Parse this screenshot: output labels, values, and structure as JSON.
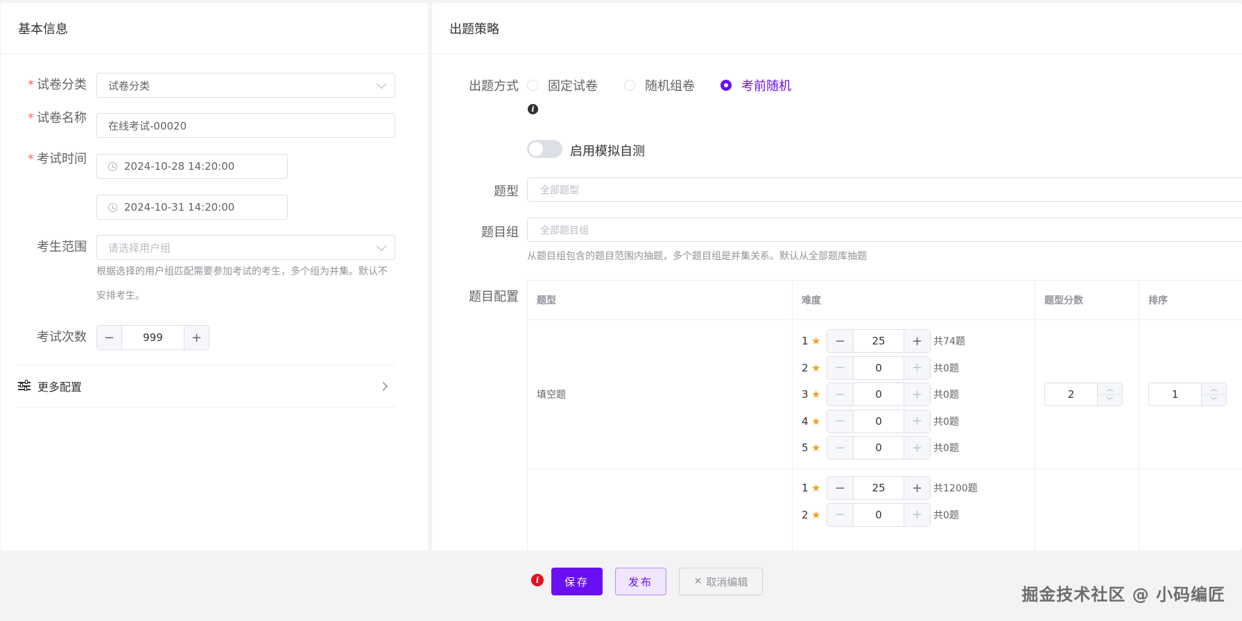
{
  "basic": {
    "title": "基本信息",
    "category": {
      "label": "试卷分类",
      "value": "试卷分类"
    },
    "name": {
      "label": "试卷名称",
      "value": "在线考试-00020"
    },
    "exam_time": {
      "label": "考试时间",
      "start": "2024-10-28 14:20:00",
      "end": "2024-10-31 14:20:00"
    },
    "scope": {
      "label": "考生范围",
      "placeholder": "请选择用户组",
      "hint": "根据选择的用户组匹配需要参加考试的考生，多个组为并集。默认不安排考生。"
    },
    "attempts": {
      "label": "考试次数",
      "value": "999",
      "minus": "−",
      "plus": "+"
    },
    "more": {
      "label": "更多配置"
    }
  },
  "strategy": {
    "title": "出题策略",
    "mode": {
      "label": "出题方式",
      "options": [
        "固定试卷",
        "随机组卷",
        "考前随机"
      ],
      "selected": "考前随机"
    },
    "simulate": {
      "label": "启用模拟自测",
      "enabled": false
    },
    "qtype": {
      "label": "题型",
      "placeholder": "全部题型"
    },
    "qgroup": {
      "label": "题目组",
      "placeholder": "全部题目组",
      "hint": "从题目组包含的题目范围内抽题，多个题目组是并集关系。默认从全部题库抽题"
    },
    "config": {
      "label": "题目配置",
      "headers": [
        "题型",
        "难度",
        "题型分数",
        "排序"
      ],
      "rows": [
        {
          "type": "填空题",
          "levels": [
            {
              "level": "1",
              "count": "25",
              "total": "共74题"
            },
            {
              "level": "2",
              "count": "0",
              "total": "共0题"
            },
            {
              "level": "3",
              "count": "0",
              "total": "共0题"
            },
            {
              "level": "4",
              "count": "0",
              "total": "共0题"
            },
            {
              "level": "5",
              "count": "0",
              "total": "共0题"
            }
          ],
          "score": "2",
          "order": "1"
        },
        {
          "type": "",
          "levels": [
            {
              "level": "1",
              "count": "25",
              "total": "共1200题"
            },
            {
              "level": "2",
              "count": "0",
              "total": "共0题"
            }
          ]
        }
      ]
    }
  },
  "footer": {
    "save": "保存",
    "publish": "发布",
    "cancel": "取消编辑",
    "watermark": "掘金技术社区 @ 小码编匠"
  },
  "colors": {
    "accent": "#6a0ff2",
    "star": "#f0a020",
    "required": "#f56c6c",
    "error": "#e4101b"
  }
}
